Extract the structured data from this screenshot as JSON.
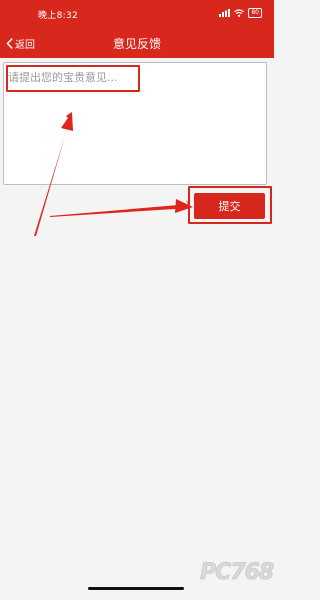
{
  "status_bar": {
    "time": "晚上8:32",
    "battery": "80",
    "icons": [
      "signal-icon",
      "wifi-icon",
      "battery-icon"
    ]
  },
  "nav": {
    "back_label": "返回",
    "title": "意见反馈"
  },
  "feedback": {
    "placeholder": "请提出您的宝贵意见...",
    "value": ""
  },
  "submit": {
    "label": "提交"
  },
  "watermark": "PC768",
  "colors": {
    "brand_red": "#d8281e",
    "page_background": "#f4f4f4",
    "placeholder_text": "#9a9a9a"
  }
}
